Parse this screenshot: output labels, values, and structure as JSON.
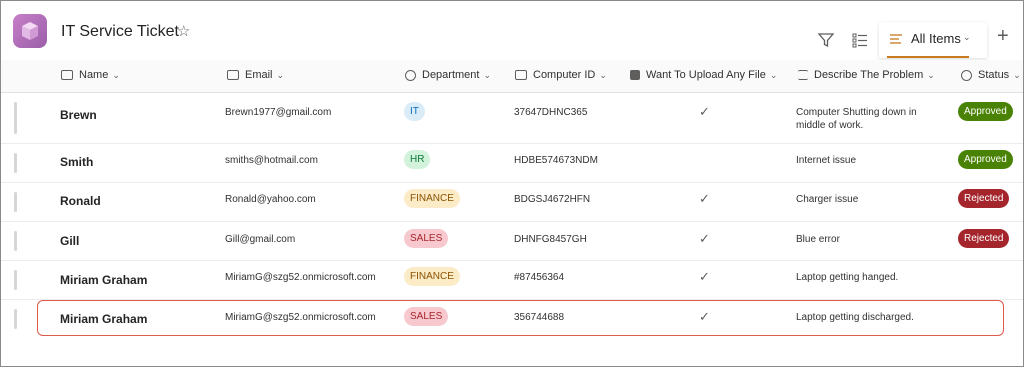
{
  "header": {
    "title": "IT Service Ticket",
    "view_label": "All Items"
  },
  "colors": {
    "it_bg": "#d9ecf7",
    "it_fg": "#0f6cbd",
    "hr_bg": "#d3f2dc",
    "hr_fg": "#0e7a3a",
    "finance_bg": "#fbebc6",
    "finance_fg": "#8a5300",
    "sales_bg": "#f7c9cf",
    "sales_fg": "#a4262c",
    "approved": "#498205",
    "rejected": "#a4262c"
  },
  "columns": [
    {
      "label": "Name",
      "icon": "text-icon"
    },
    {
      "label": "Email",
      "icon": "text-icon"
    },
    {
      "label": "Department",
      "icon": "choice-icon"
    },
    {
      "label": "Computer ID",
      "icon": "text-icon"
    },
    {
      "label": "Want To Upload Any File",
      "icon": "yesno-icon"
    },
    {
      "label": "Describe The Problem",
      "icon": "multiline-icon"
    },
    {
      "label": "Status",
      "icon": "choice-icon"
    }
  ],
  "rows": [
    {
      "name": "Brewn",
      "email": "Brewn1977@gmail.com",
      "department": "IT",
      "computer_id": "37647DHNC365",
      "upload": "✓",
      "problem": "Computer Shutting down in middle of work.",
      "status": "Approved"
    },
    {
      "name": "Smith",
      "email": "smiths@hotmail.com",
      "department": "HR",
      "computer_id": "HDBE574673NDM",
      "upload": "",
      "problem": "Internet issue",
      "status": "Approved"
    },
    {
      "name": "Ronald",
      "email": "Ronald@yahoo.com",
      "department": "FINANCE",
      "computer_id": "BDGSJ4672HFN",
      "upload": "✓",
      "problem": "Charger issue",
      "status": "Rejected"
    },
    {
      "name": "Gill",
      "email": "Gill@gmail.com",
      "department": "SALES",
      "computer_id": "DHNFG8457GH",
      "upload": "✓",
      "problem": "Blue error",
      "status": "Rejected"
    },
    {
      "name": "Miriam Graham",
      "email": "MiriamG@szg52.onmicrosoft.com",
      "department": "FINANCE",
      "computer_id": "#87456364",
      "upload": "✓",
      "problem": "Laptop getting hanged.",
      "status": ""
    },
    {
      "name": "Miriam Graham",
      "email": "MiriamG@szg52.onmicrosoft.com",
      "department": "SALES",
      "computer_id": "356744688",
      "upload": "✓",
      "problem": "Laptop getting discharged.",
      "status": ""
    }
  ]
}
